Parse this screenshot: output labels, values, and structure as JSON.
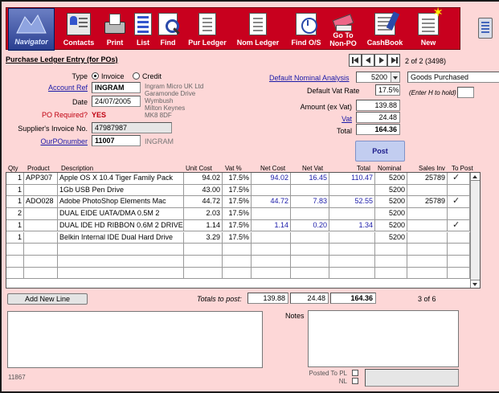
{
  "toolbar": {
    "buttons": [
      {
        "label": "Navigator",
        "icon": "navigator-icon"
      },
      {
        "label": "Contacts",
        "icon": "contacts-icon"
      },
      {
        "label": "Print",
        "icon": "printer-icon"
      },
      {
        "label": "List",
        "icon": "list-icon"
      },
      {
        "label": "Find",
        "icon": "find-icon"
      },
      {
        "label": "Pur Ledger",
        "icon": "purchase-ledger-icon"
      },
      {
        "label": "Nom Ledger",
        "icon": "nominal-ledger-icon"
      },
      {
        "label": "Find O/S",
        "icon": "find-outstanding-icon"
      },
      {
        "label": "Go To",
        "label2": "Non-PO",
        "icon": "go-to-non-po-icon"
      },
      {
        "label": "CashBook",
        "icon": "cashbook-icon"
      },
      {
        "label": "New",
        "icon": "new-record-icon"
      }
    ]
  },
  "page": {
    "title": "Purchase Ledger Entry (for POs)",
    "record_position": "2 of 2 (3498)"
  },
  "form": {
    "type_label": "Type",
    "type_options": [
      "Invoice",
      "Credit"
    ],
    "type_selected": "Invoice",
    "account_ref_label": "Account Ref",
    "account_ref": "INGRAM",
    "supplier_address": [
      "Ingram Micro UK Ltd",
      "Garamonde Drive",
      "Wymbush",
      "Milton Keynes",
      "MK8 8DF"
    ],
    "date_label": "Date",
    "date": "24/07/2005",
    "po_required_label": "PO Required?",
    "po_required": "YES",
    "supplier_invoice_label": "Supplier's Invoice  No.",
    "supplier_invoice": "47987987",
    "our_po_label": "OurPOnumber",
    "our_po": "11007",
    "our_po_supplier": "INGRAM",
    "default_nominal_label": "Default Nominal Analysis",
    "default_nominal": "5200",
    "default_nominal_desc": "Goods Purchased",
    "default_vat_label": "Default Vat Rate",
    "default_vat": "17.5%",
    "hold_label": "(Enter H to hold)",
    "hold_value": "",
    "amount_label": "Amount (ex Vat)",
    "amount": "139.88",
    "vat_label": "Vat",
    "vat": "24.48",
    "total_label": "Total",
    "total": "164.36",
    "post_label": "Post"
  },
  "table": {
    "headers": [
      "Qty",
      "Product",
      "Description",
      "Unit Cost",
      "Vat %",
      "Net Cost",
      "Net Vat",
      "Total",
      "Nominal",
      "Sales Inv",
      "To Post"
    ],
    "rows": [
      {
        "qty": "1",
        "product": "APP307",
        "description": "Apple OS X 10.4 Tiger Family Pack",
        "unit_cost": "94.02",
        "vat_pct": "17.5%",
        "net_cost": "94.02",
        "net_vat": "16.45",
        "total": "110.47",
        "nominal": "5200",
        "sales_inv": "25789",
        "to_post": "✓"
      },
      {
        "qty": "1",
        "product": "",
        "description": "1Gb USB Pen Drive",
        "unit_cost": "43.00",
        "vat_pct": "17.5%",
        "net_cost": "",
        "net_vat": "",
        "total": "",
        "nominal": "5200",
        "sales_inv": "",
        "to_post": ""
      },
      {
        "qty": "1",
        "product": "ADO028",
        "description": "Adobe PhotoShop Elements Mac",
        "unit_cost": "44.72",
        "vat_pct": "17.5%",
        "net_cost": "44.72",
        "net_vat": "7.83",
        "total": "52.55",
        "nominal": "5200",
        "sales_inv": "25789",
        "to_post": "✓"
      },
      {
        "qty": "2",
        "product": "",
        "description": "DUAL EIDE UATA/DMA 0.5M 2",
        "unit_cost": "2.03",
        "vat_pct": "17.5%",
        "net_cost": "",
        "net_vat": "",
        "total": "",
        "nominal": "5200",
        "sales_inv": "",
        "to_post": ""
      },
      {
        "qty": "1",
        "product": "",
        "description": "DUAL IDE HD RIBBON 0.6M 2 DRIVE",
        "unit_cost": "1.14",
        "vat_pct": "17.5%",
        "net_cost": "1.14",
        "net_vat": "0.20",
        "total": "1.34",
        "nominal": "5200",
        "sales_inv": "",
        "to_post": "✓"
      },
      {
        "qty": "1",
        "product": "",
        "description": "Belkin Internal IDE Dual Hard Drive",
        "unit_cost": "3.29",
        "vat_pct": "17.5%",
        "net_cost": "",
        "net_vat": "",
        "total": "",
        "nominal": "5200",
        "sales_inv": "",
        "to_post": ""
      }
    ]
  },
  "footer": {
    "add_line_label": "Add  New  Line",
    "totals_label": "Totals to post:",
    "totals_net": "139.88",
    "totals_vat": "24.48",
    "totals_total": "164.36",
    "line_count": "3 of 6",
    "notes_label": "Notes",
    "posted_pl_label": "Posted To PL",
    "posted_nl_label": "NL",
    "record_id": "11867"
  },
  "colors": {
    "background": "#fdd7d7",
    "toolbar": "#c8001e",
    "link": "#1a1aa8",
    "warning": "#c00010"
  }
}
